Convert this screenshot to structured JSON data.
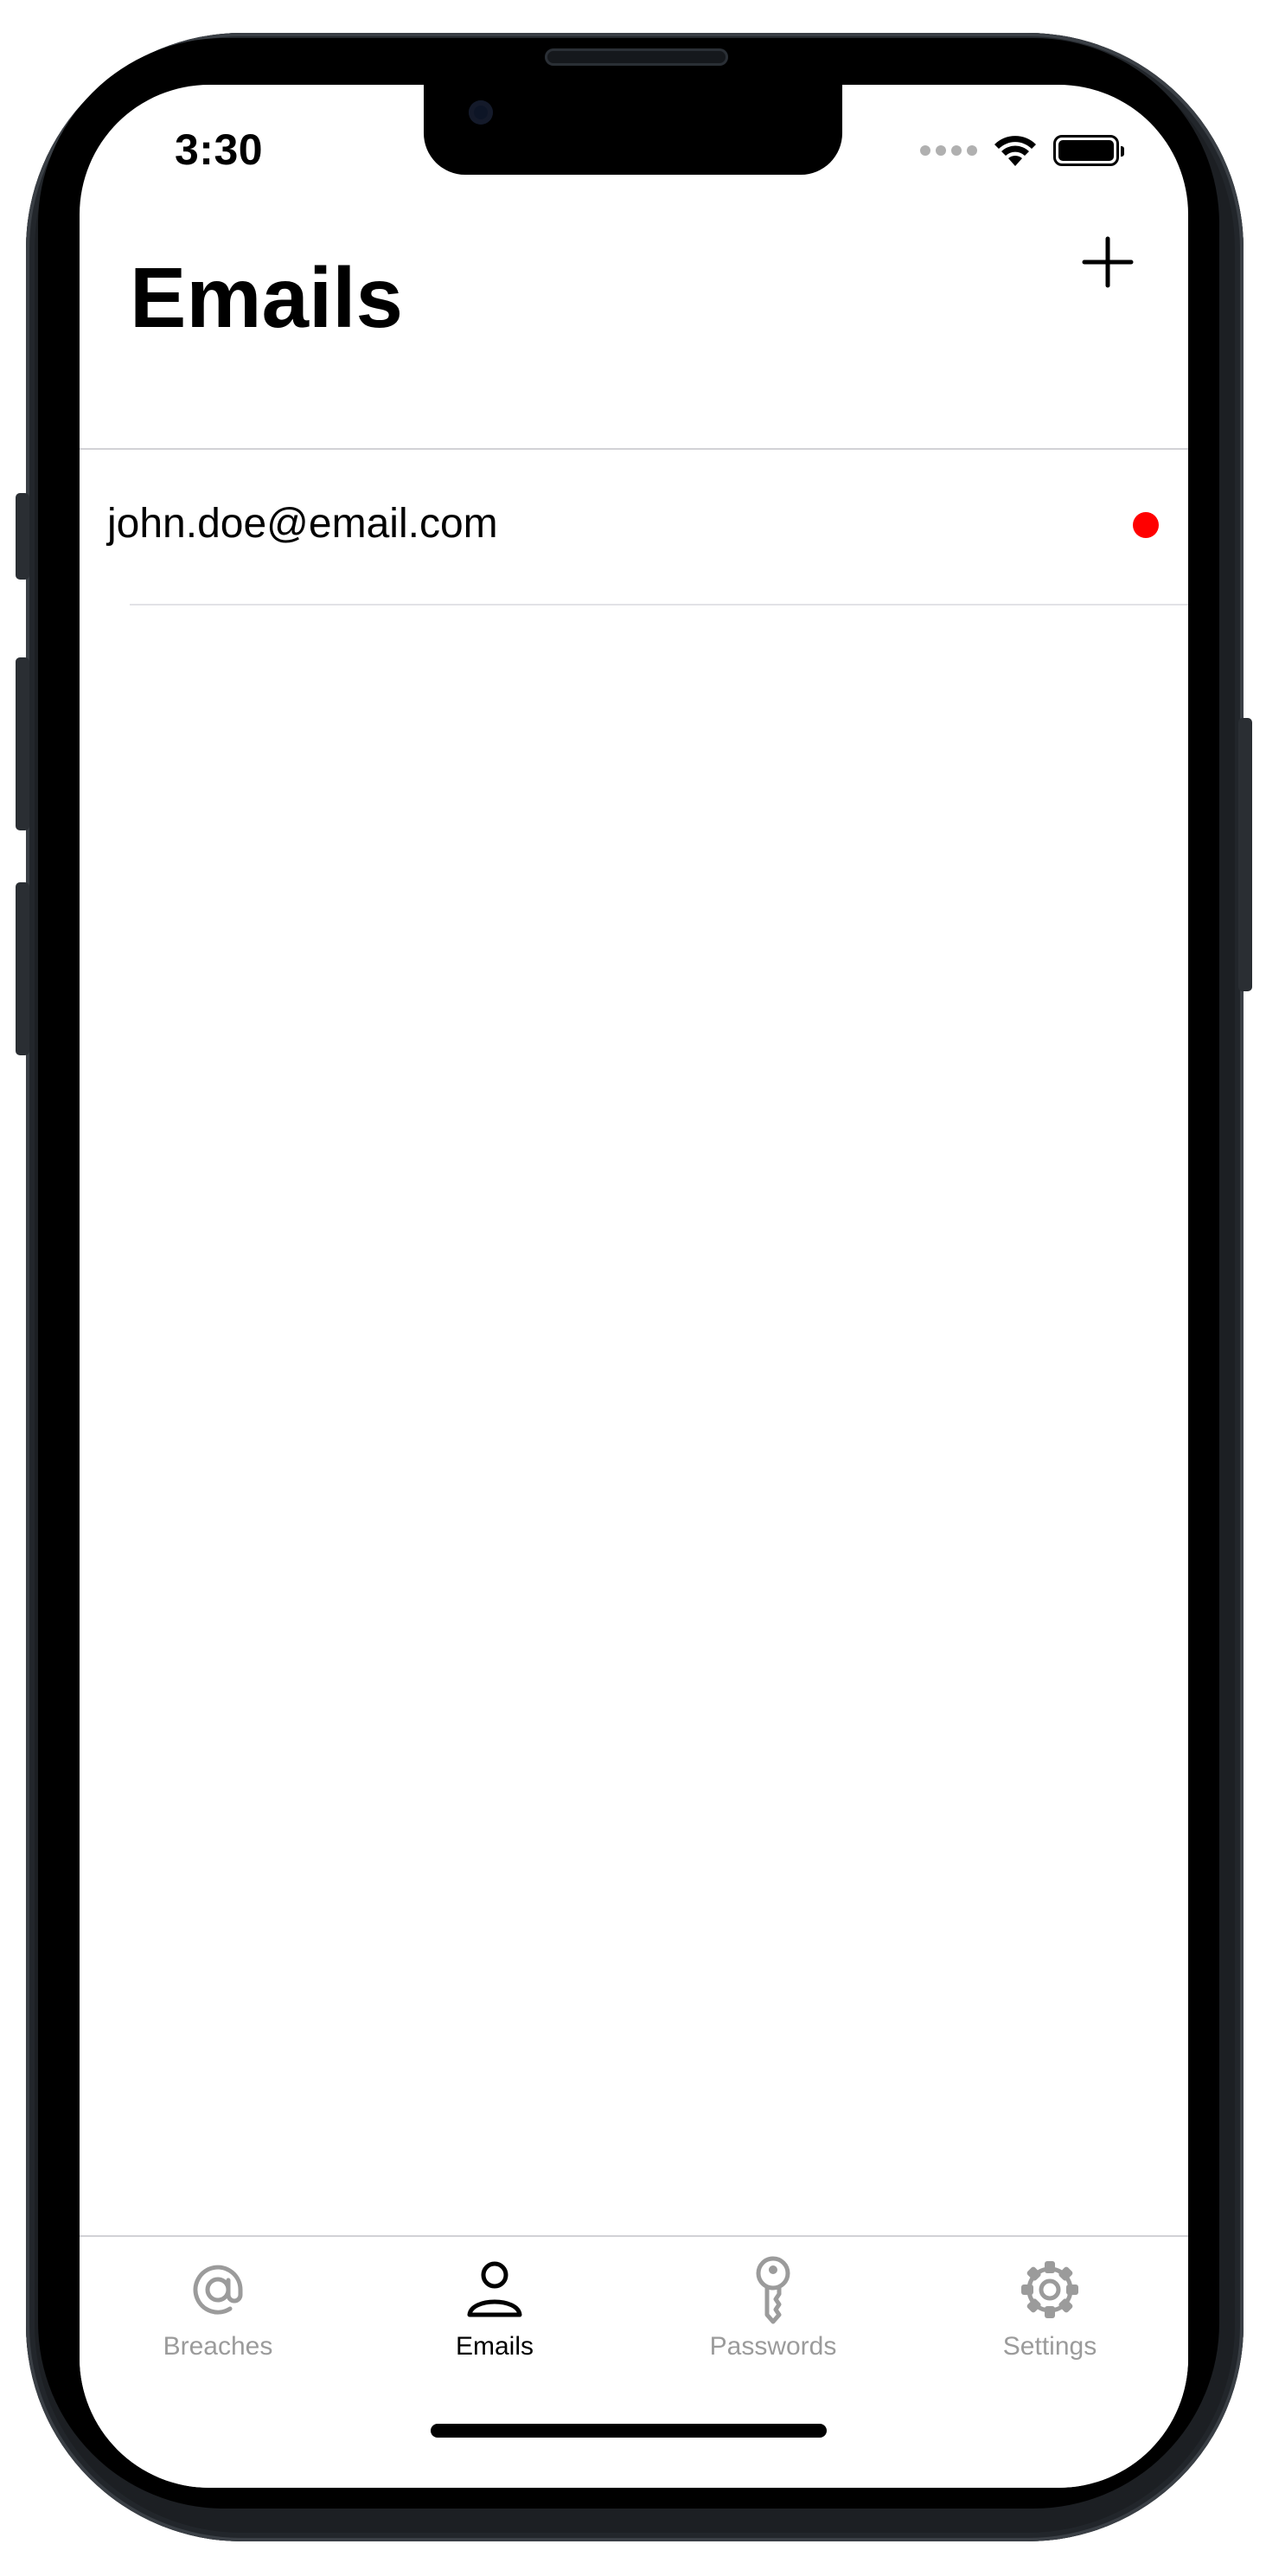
{
  "status_bar": {
    "time": "3:30",
    "battery_level": 1.0
  },
  "nav": {
    "title": "Emails",
    "add_icon": "plus-icon"
  },
  "emails": [
    {
      "address": "john.doe@email.com",
      "status_color": "#ff0000"
    }
  ],
  "tabs": [
    {
      "label": "Breaches",
      "icon": "at-sign-icon",
      "active": false
    },
    {
      "label": "Emails",
      "icon": "person-icon",
      "active": true
    },
    {
      "label": "Passwords",
      "icon": "key-icon",
      "active": false
    },
    {
      "label": "Settings",
      "icon": "gear-icon",
      "active": false
    }
  ],
  "colors": {
    "tab_active": "#000000",
    "tab_inactive": "#9b9b9b",
    "breach_indicator": "#ff0000"
  }
}
